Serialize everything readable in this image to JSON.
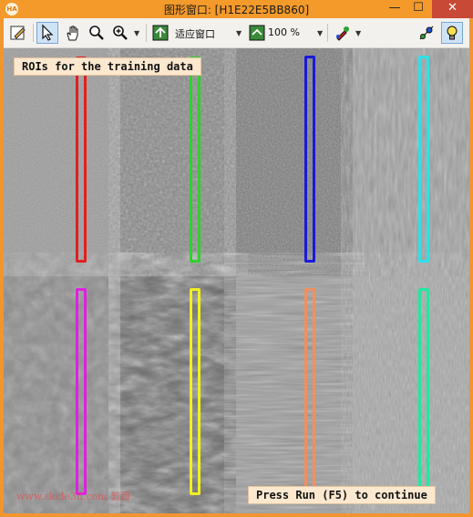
{
  "window": {
    "title": "图形窗口: [H1E22E5BB860]",
    "app_icon_text": "HA",
    "minimize_glyph": "—",
    "maximize_glyph": "☐",
    "close_glyph": "✕"
  },
  "toolbar": {
    "zoom_mode": "适应窗口",
    "zoom_percent": "100 %",
    "dropdown_glyph": "▼"
  },
  "canvas": {
    "label_top": "ROIs for the training data",
    "label_bottom": "Press Run (F5) to continue",
    "watermark": "www.skcle3ll.com  剪哥",
    "roi_colors": [
      "#e02020",
      "#30d030",
      "#1a1ad8",
      "#30e0e8",
      "#e020e0",
      "#f0f020",
      "#f09060",
      "#20e8a0"
    ],
    "tile_tones": [
      "#9a9a9a",
      "#8a8a8a",
      "#7c7c7c",
      "#a2a2a2",
      "#8e8e8e",
      "#6a6a6a",
      "#9c9c9c",
      "#aaaaaa"
    ]
  }
}
